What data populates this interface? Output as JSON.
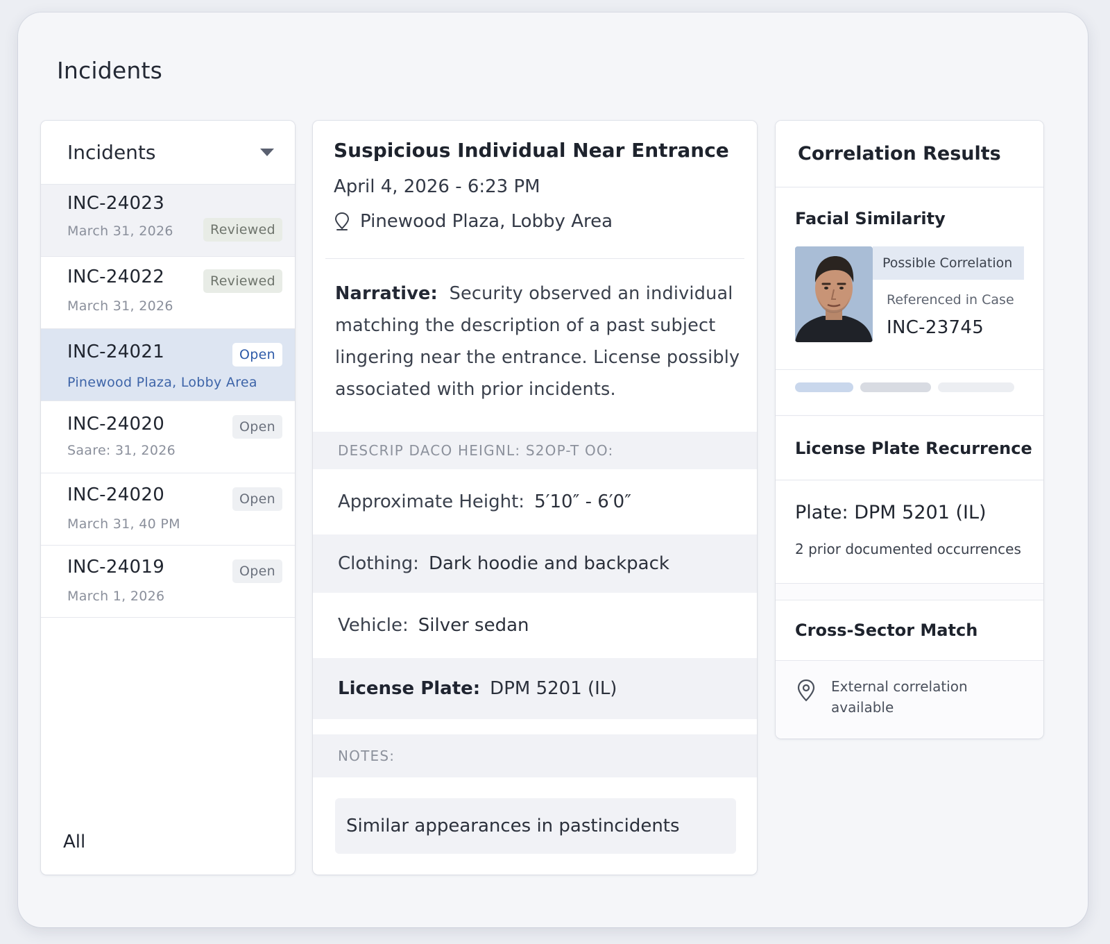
{
  "app": {
    "title": "Incidents"
  },
  "list": {
    "dropdown_label": "Incidents",
    "filter_label": "All",
    "items": [
      {
        "id": "INC-24023",
        "sub": "March 31, 2026",
        "badge": "Reviewed"
      },
      {
        "id": "INC-24022",
        "sub": "March 31, 2026",
        "badge": "Reviewed"
      },
      {
        "id": "INC-24021",
        "sub": "Pinewood Plaza, Lobby Area",
        "badge": "Open"
      },
      {
        "id": "INC-24020",
        "sub": "Saare: 31, 2026",
        "badge": "Open"
      },
      {
        "id": "INC-24020",
        "sub": "March 31, 40 PM",
        "badge": "Open"
      },
      {
        "id": "INC-24019",
        "sub": "March 1, 2026",
        "badge": "Open"
      }
    ]
  },
  "detail": {
    "title": "Suspicious Individual Near Entrance",
    "datetime": "April 4, 2026 - 6:23 PM",
    "location": "Pinewood Plaza, Lobby Area",
    "narrative_label": "Narrative:",
    "narrative_text": "Security observed an individual matching the description of a past subject lingering near the entrance. License possibly associated with prior incidents.",
    "description_header": "DESCRIP DACO HEIGNL: S2OP-T OO:",
    "fields": [
      {
        "label": "Approximate Height:",
        "value": "5′10″ - 6′0″"
      },
      {
        "label": "Clothing:",
        "value": "Dark hoodie and backpack"
      },
      {
        "label": "Vehicle:",
        "value": "Silver sedan"
      },
      {
        "label": "License Plate:",
        "value": "DPM 5201 (IL)"
      }
    ],
    "notes_header": "NOTES:",
    "notes_text": "Similar appearances in pastincidents"
  },
  "correlation": {
    "title": "Correlation Results",
    "facial": {
      "title": "Facial Similarity",
      "tag": "Possible Correlation",
      "ref_label": "Referenced in Case",
      "ref_id": "INC-23745"
    },
    "lpr": {
      "title": "License Plate Recurrence",
      "plate": "Plate: DPM 5201 (IL)",
      "occurrences": "2 prior documented occurrences"
    },
    "cross": {
      "title": "Cross-Sector Match",
      "text": "External correlation available"
    }
  },
  "colors": {
    "accent": "#2d5aa8",
    "selected_row": "#dde5f2",
    "band": "#f1f2f6",
    "skeleton": [
      "#c9d7ec",
      "#d8dbe2",
      "#eceef2"
    ]
  },
  "icons": {
    "dropdown": "chevron-down-icon",
    "location": "location-pin-icon",
    "cross_sector": "location-pin-icon"
  }
}
